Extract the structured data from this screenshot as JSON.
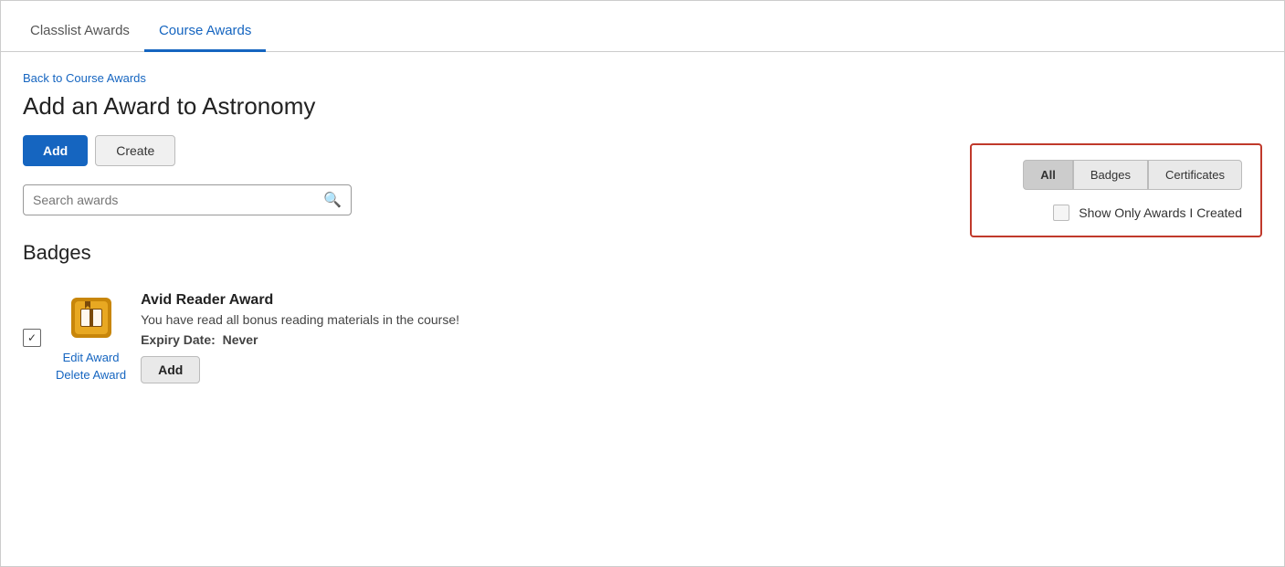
{
  "tabs": [
    {
      "id": "classlist-awards",
      "label": "Classlist Awards",
      "active": false
    },
    {
      "id": "course-awards",
      "label": "Course Awards",
      "active": true
    }
  ],
  "back_link": "Back to Course Awards",
  "page_title": "Add an Award to Astronomy",
  "buttons": {
    "add_label": "Add",
    "create_label": "Create"
  },
  "search": {
    "placeholder": "Search awards"
  },
  "filter_panel": {
    "type_buttons": [
      {
        "id": "all",
        "label": "All",
        "active": true
      },
      {
        "id": "badges",
        "label": "Badges",
        "active": false
      },
      {
        "id": "certificates",
        "label": "Certificates",
        "active": false
      }
    ],
    "checkbox_label": "Show Only Awards I Created",
    "checked": false
  },
  "badges_section_title": "Badges",
  "awards": [
    {
      "name": "Avid Reader Award",
      "description": "You have read all bonus reading materials in the course!",
      "expiry_label": "Expiry Date:",
      "expiry_value": "Never",
      "checked": true,
      "edit_label": "Edit Award",
      "delete_label": "Delete Award",
      "add_label": "Add"
    }
  ],
  "colors": {
    "active_tab": "#1565c0",
    "add_button_bg": "#1565c0",
    "filter_border": "#c0392b"
  }
}
